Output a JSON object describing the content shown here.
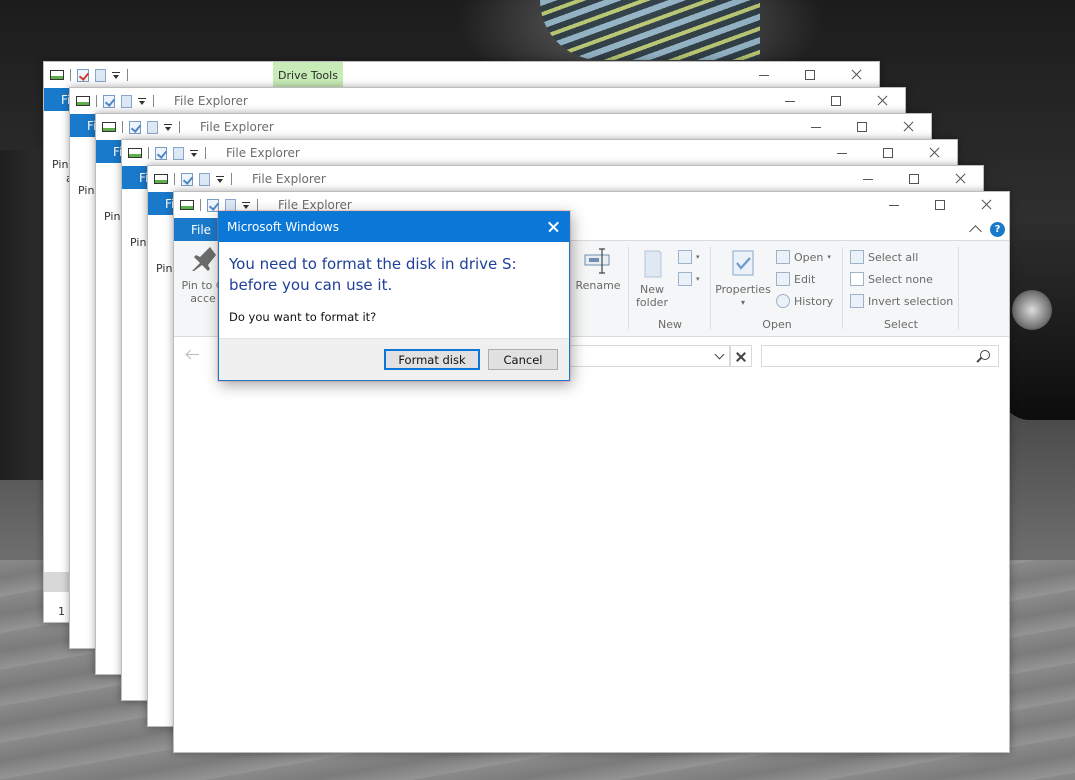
{
  "explorer": {
    "title": "File Explorer",
    "file_tab": "File",
    "context_tab": "Drive Tools",
    "peek": {
      "pin_label": "Pin",
      "pin_label_2": "a",
      "status_prefix": "1 i"
    },
    "ribbon": {
      "pin": {
        "line1": "Pin to Q",
        "line2": "acce"
      },
      "rename": "Rename",
      "new_folder_line1": "New",
      "new_folder_line2": "folder",
      "group_new": "New",
      "properties": "Properties",
      "open": "Open",
      "edit": "Edit",
      "history": "History",
      "group_open": "Open",
      "select_all": "Select all",
      "select_none": "Select none",
      "invert_selection": "Invert selection",
      "group_select": "Select",
      "help": "?"
    }
  },
  "dialog": {
    "title": "Microsoft Windows",
    "message": "You need to format the disk in drive S: before you can use it.",
    "question": "Do you want to format it?",
    "primary_button": "Format disk",
    "cancel_button": "Cancel"
  },
  "colors": {
    "accent": "#0b78d7",
    "file_tab": "#1979ca",
    "drive_tools_tab": "#c8ecb7",
    "message_text": "#1f3f9a"
  }
}
